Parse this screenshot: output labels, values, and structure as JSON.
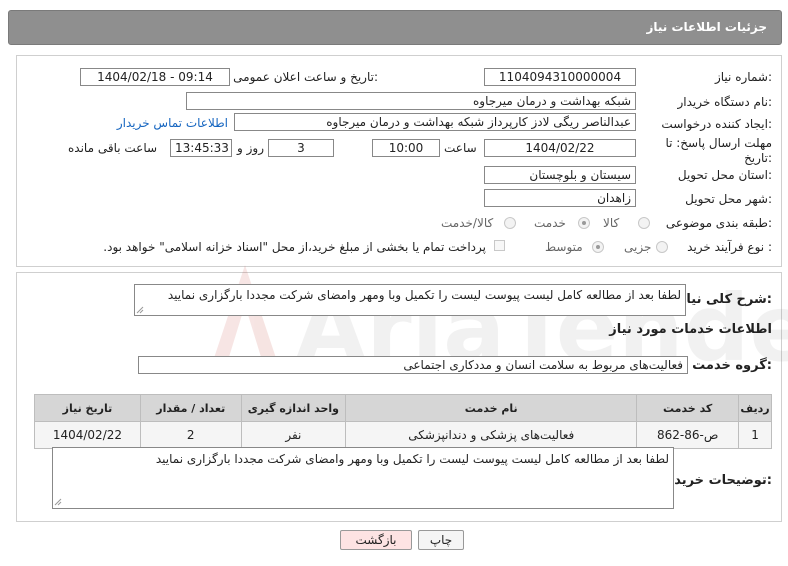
{
  "header": {
    "title": "جزئیات اطلاعات نیاز"
  },
  "fields": {
    "need_number_label": "شماره نیاز:",
    "need_number": "1104094310000004",
    "announce_label": "تاریخ و ساعت اعلان عمومی:",
    "announce_value": "1404/02/18 - 09:14",
    "buyer_org_label": "نام دستگاه خریدار:",
    "buyer_org": "شبکه بهداشت و درمان میرجاوه",
    "creator_label": "ایجاد کننده درخواست:",
    "creator": "عبدالناصر  ریگی لادز کارپرداز شبکه بهداشت و درمان میرجاوه",
    "contact_link": "اطلاعات تماس خریدار",
    "deadline_label": "مهلت ارسال پاسخ: تا تاریخ:",
    "deadline_date": "1404/02/22",
    "time_label": "ساعت",
    "deadline_time": "10:00",
    "days_value": "3",
    "days_label": "روز و",
    "remaining_time": "13:45:33",
    "remaining_label": "ساعت باقی مانده",
    "province_label": "استان محل تحویل:",
    "province": "سیستان و بلوچستان",
    "city_label": "شهر محل تحویل:",
    "city": "زاهدان",
    "category_label": "طبقه بندی موضوعی:",
    "category_options": [
      "کالا",
      "خدمت",
      "کالا/خدمت"
    ],
    "category_selected": 1,
    "process_label": "نوع فرآیند خرید :",
    "process_options": [
      "جزیی",
      "متوسط"
    ],
    "process_selected": 1,
    "process_note": "پرداخت تمام یا بخشی از مبلغ خرید،از محل \"اسناد خزانه اسلامی\" خواهد بود."
  },
  "summary": {
    "label": "شرح کلی نیاز:",
    "text": "لطفا بعد از مطالعه کامل لیست پیوست لیست را تکمیل وبا ومهر وامضای شرکت مجددا بارگزاری نمایید"
  },
  "services": {
    "section_title": "اطلاعات خدمات مورد نیاز",
    "group_label": "گروه خدمت:",
    "group_value": "فعالیت‌های مربوط به سلامت انسان و مددکاری اجتماعی",
    "table": {
      "headers": [
        "ردیف",
        "کد خدمت",
        "نام خدمت",
        "واحد اندازه گیری",
        "تعداد / مقدار",
        "تاریخ نیاز"
      ],
      "rows": [
        [
          "1",
          "ص-86-862",
          "فعالیت‌های پزشکی و دندانپزشکی",
          "نفر",
          "2",
          "1404/02/22"
        ]
      ]
    }
  },
  "buyer_notes": {
    "label": "توضیحات خریدار:",
    "text": "لطفا بعد از مطالعه کامل لیست پیوست لیست را تکمیل وبا ومهر وامضای شرکت مجددا بارگزاری نمایید"
  },
  "buttons": {
    "print": "چاپ",
    "back": "بازگشت"
  },
  "watermark": {
    "text": "AriaTender.neT"
  },
  "colors": {
    "header_bg": "#8f8f8f",
    "link": "#1565c0",
    "table_header": "#d6d6d6",
    "back_button": "#fde3e3"
  }
}
